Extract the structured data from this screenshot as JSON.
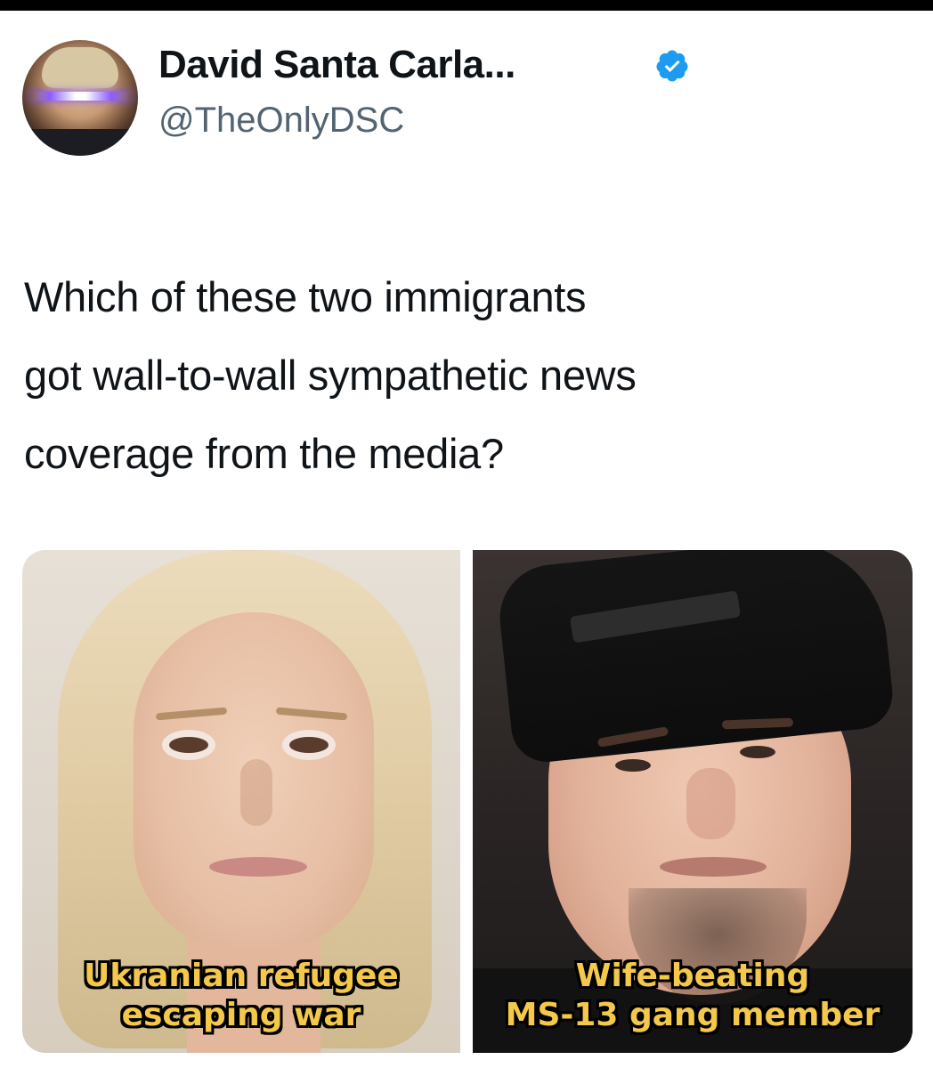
{
  "tweet": {
    "author": {
      "display_name": "David Santa Carla...",
      "handle": "@TheOnlyDSC",
      "verified": true
    },
    "text_lines": [
      "Which of these two immigrants",
      "got wall-to-wall sympathetic news",
      "coverage from the media?"
    ]
  },
  "media": {
    "left_caption_lines": [
      "Ukranian refugee",
      "escaping war"
    ],
    "right_caption_lines": [
      "Wife-beating",
      "MS-13 gang member"
    ]
  },
  "colors": {
    "verified_badge": "#1d9bf0",
    "caption_text": "#f4c84a",
    "handle_gray": "#536471"
  },
  "icons": {
    "verified": "verified-badge-icon"
  }
}
